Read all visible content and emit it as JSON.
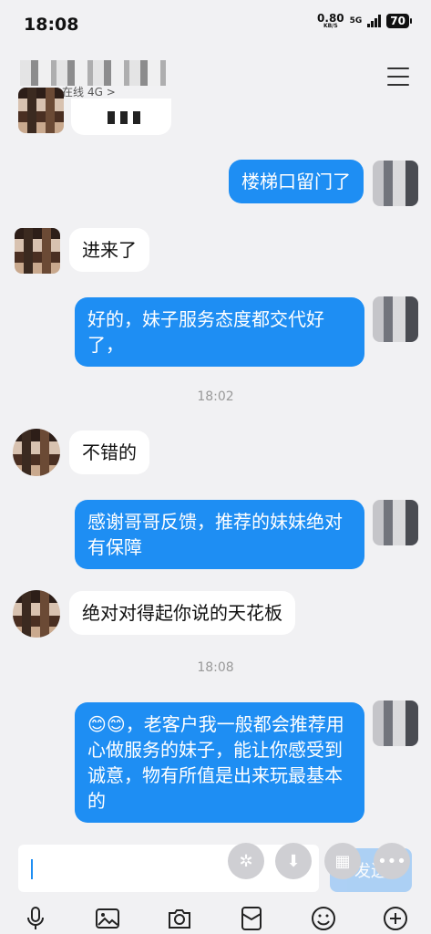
{
  "status_bar": {
    "time": "18:08",
    "net_speed": "0.80",
    "net_unit": "KB/S",
    "network": "5G",
    "battery": "70"
  },
  "header": {
    "presence": "在线",
    "presence_suffix": "4G >"
  },
  "messages": [
    {
      "side": "out",
      "text": "楼梯口留门了"
    },
    {
      "side": "in",
      "text": "进来了"
    },
    {
      "side": "out",
      "text": "好的，妹子服务态度都交代好了，"
    },
    {
      "type": "time",
      "text": "18:02"
    },
    {
      "side": "in",
      "text": "不错的"
    },
    {
      "side": "out",
      "text": "感谢哥哥反馈，推荐的妹妹绝对有保障"
    },
    {
      "side": "in",
      "text": "绝对对得起你说的天花板"
    },
    {
      "type": "time",
      "text": "18:08"
    },
    {
      "side": "out",
      "text": "😊😊，老客户我一般都会推荐用心做服务的妹子，能让你感受到诚意，物有所值是出来玩最基本的"
    }
  ],
  "composer": {
    "send_label": "发送"
  },
  "toolbar": [
    "microphone-icon",
    "image-icon",
    "camera-icon",
    "red-packet-icon",
    "emoji-icon",
    "plus-icon"
  ]
}
